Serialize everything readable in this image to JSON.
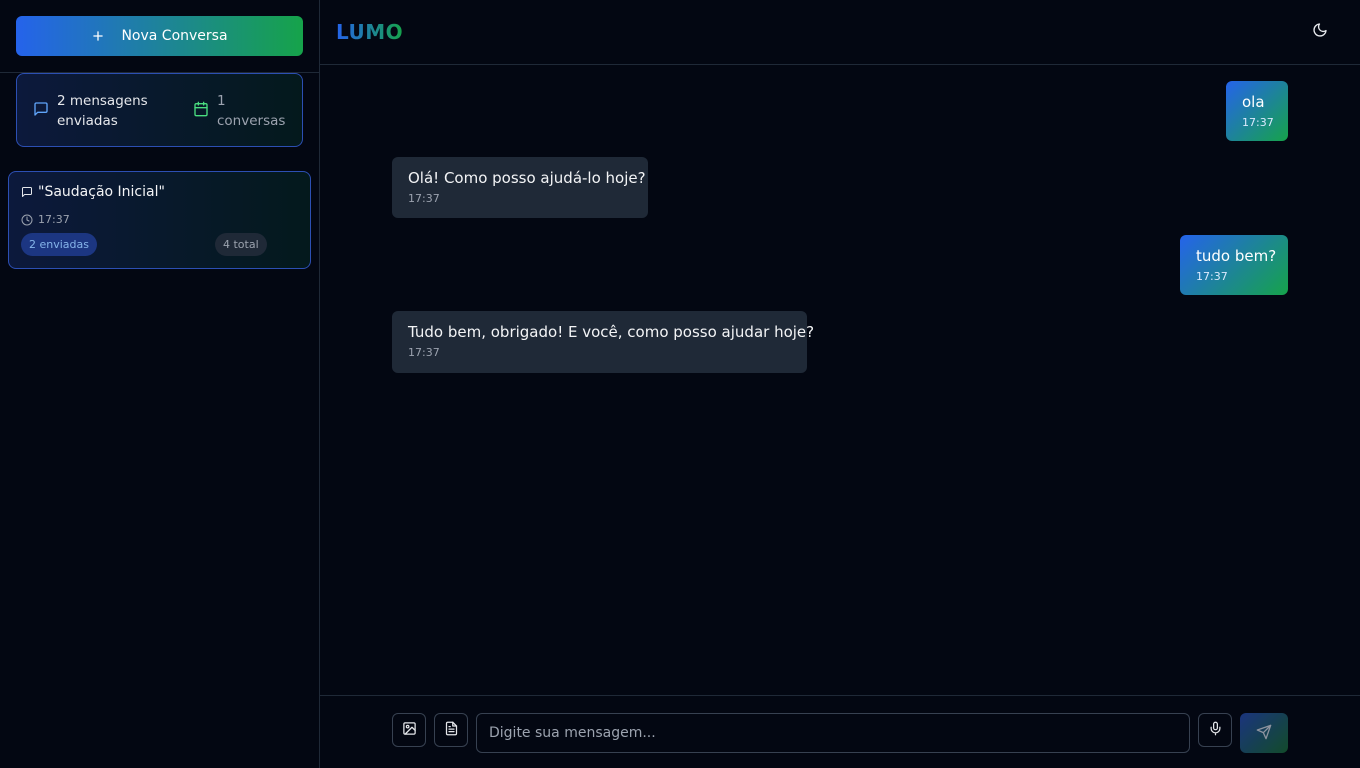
{
  "sidebar": {
    "new_chat_label": "Nova Conversa",
    "stats": {
      "sent_text": "2 mensagens enviadas",
      "conversations_text": "1 conversas"
    },
    "conversations": [
      {
        "title": "\"Saudação Inicial\"",
        "time": "17:37",
        "sent_badge": "2 enviadas",
        "total_badge": "4 total"
      }
    ]
  },
  "header": {
    "title": "LUMO"
  },
  "messages": [
    {
      "role": "user",
      "text": "ola",
      "time": "17:37"
    },
    {
      "role": "assistant",
      "text": "Olá! Como posso ajudá-lo hoje?",
      "time": "17:37"
    },
    {
      "role": "user",
      "text": "tudo bem?",
      "time": "17:37"
    },
    {
      "role": "assistant",
      "text": "Tudo bem, obrigado! E você, como posso ajudar hoje?",
      "time": "17:37"
    }
  ],
  "composer": {
    "placeholder": "Digite sua mensagem..."
  },
  "colors": {
    "background": "#030712",
    "accent_blue": "#2563eb",
    "accent_green": "#16a34a",
    "bubble_assistant": "#1f2937"
  },
  "icons": {
    "new_chat": "plus-icon",
    "sent": "message-square-icon",
    "conversations": "calendar-icon",
    "conversation": "message-square-icon",
    "time": "clock-icon",
    "theme": "moon-icon",
    "image": "image-icon",
    "document": "file-text-icon",
    "mic": "mic-icon",
    "send": "send-icon"
  }
}
